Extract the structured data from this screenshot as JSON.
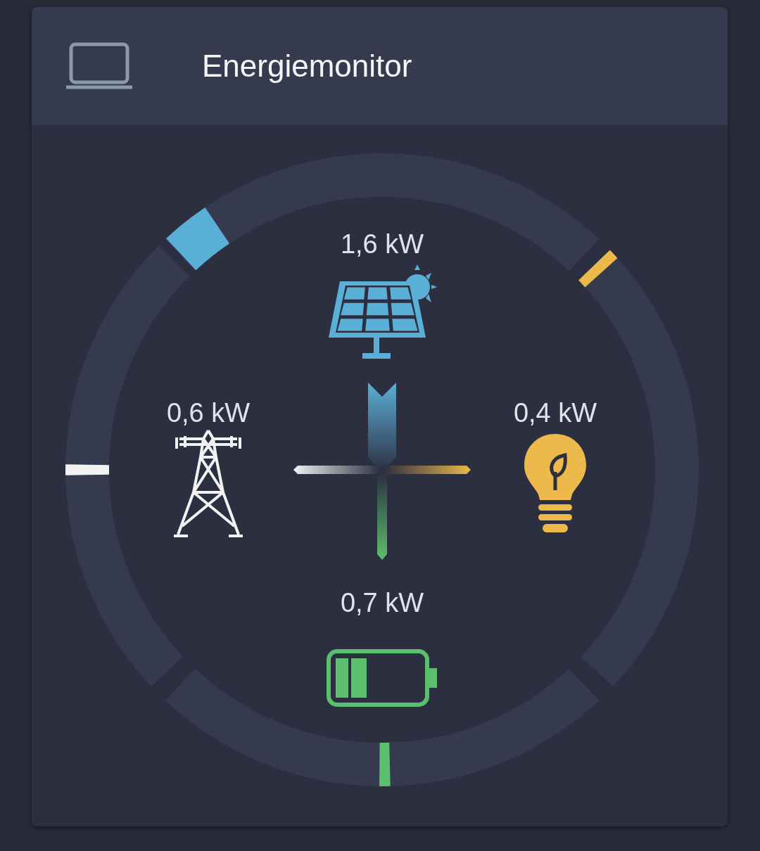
{
  "card": {
    "title": "Energiemonitor"
  },
  "nodes": [
    {
      "kind": "solar",
      "value": "1,6 kW",
      "color": "#5aafd6"
    },
    {
      "kind": "grid",
      "value": "0,6 kW",
      "color": "#f2f2f2"
    },
    {
      "kind": "consumer",
      "value": "0,4 kW",
      "color": "#ecb94a"
    },
    {
      "kind": "battery",
      "value": "0,7 kW",
      "color": "#5cbf6e"
    }
  ]
}
